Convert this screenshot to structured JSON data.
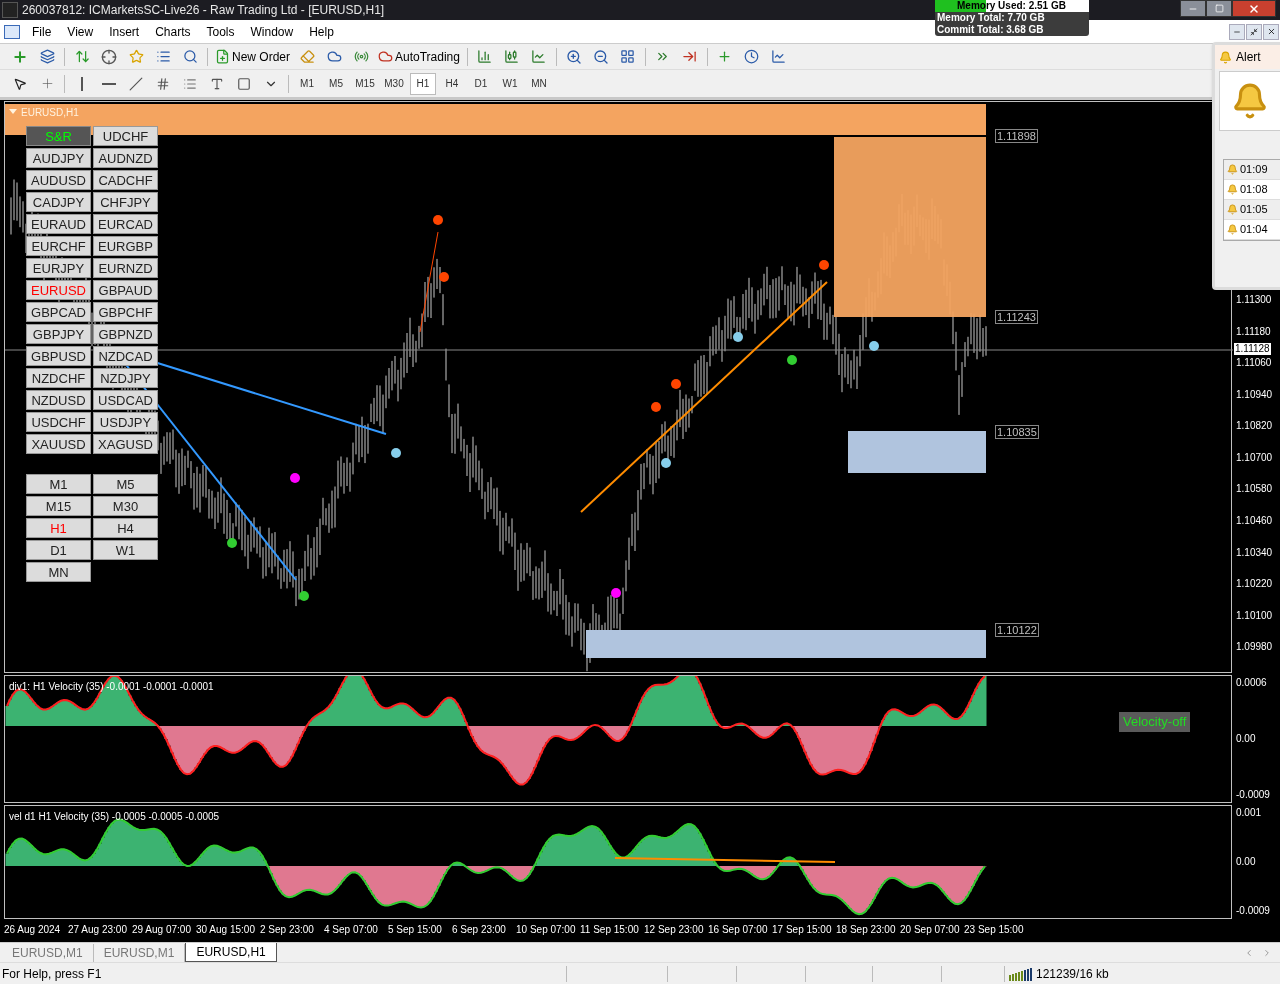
{
  "window": {
    "title": "260037812: ICMarketsSC-Live26 - Raw Trading Ltd - [EURUSD,H1]"
  },
  "memory": {
    "used": "Memory Used: 2.51 GB",
    "level": 0.33,
    "total": "Memory Total: 7.70 GB",
    "commit": "Commit Total: 3.68 GB"
  },
  "menu": [
    "File",
    "View",
    "Insert",
    "Charts",
    "Tools",
    "Window",
    "Help"
  ],
  "toolbar": {
    "new_order": "New Order",
    "auto_trading": "AutoTrading"
  },
  "timeframes": [
    {
      "label": "M1",
      "selected": false
    },
    {
      "label": "M5",
      "selected": false
    },
    {
      "label": "M15",
      "selected": false
    },
    {
      "label": "M30",
      "selected": false
    },
    {
      "label": "H1",
      "selected": true
    },
    {
      "label": "H4",
      "selected": false
    },
    {
      "label": "D1",
      "selected": false
    },
    {
      "label": "W1",
      "selected": false
    },
    {
      "label": "MN",
      "selected": false
    }
  ],
  "chart": {
    "title": "EURUSD,H1",
    "sr_button": "S&R",
    "symbols": [
      {
        "label": "UDCHF",
        "selected": false
      },
      {
        "label": "AUDJPY",
        "selected": false
      },
      {
        "label": "AUDNZD",
        "selected": false
      },
      {
        "label": "AUDUSD",
        "selected": false
      },
      {
        "label": "CADCHF",
        "selected": false
      },
      {
        "label": "CADJPY",
        "selected": false
      },
      {
        "label": "CHFJPY",
        "selected": false
      },
      {
        "label": "EURAUD",
        "selected": false
      },
      {
        "label": "EURCAD",
        "selected": false
      },
      {
        "label": "EURCHF",
        "selected": false
      },
      {
        "label": "EURGBP",
        "selected": false
      },
      {
        "label": "EURJPY",
        "selected": false
      },
      {
        "label": "EURNZD",
        "selected": false
      },
      {
        "label": "EURUSD",
        "selected": true
      },
      {
        "label": "GBPAUD",
        "selected": false
      },
      {
        "label": "GBPCAD",
        "selected": false
      },
      {
        "label": "GBPCHF",
        "selected": false
      },
      {
        "label": "GBPJPY",
        "selected": false
      },
      {
        "label": "GBPNZD",
        "selected": false
      },
      {
        "label": "GBPUSD",
        "selected": false
      },
      {
        "label": "NZDCAD",
        "selected": false
      },
      {
        "label": "NZDCHF",
        "selected": false
      },
      {
        "label": "NZDJPY",
        "selected": false
      },
      {
        "label": "NZDUSD",
        "selected": false
      },
      {
        "label": "USDCAD",
        "selected": false
      },
      {
        "label": "USDCHF",
        "selected": false
      },
      {
        "label": "USDJPY",
        "selected": false
      },
      {
        "label": "XAUUSD",
        "selected": false
      },
      {
        "label": "XAGUSD",
        "selected": false
      }
    ],
    "periods": [
      {
        "label": "M1",
        "selected": false
      },
      {
        "label": "M5",
        "selected": false
      },
      {
        "label": "M15",
        "selected": false
      },
      {
        "label": "M30",
        "selected": false
      },
      {
        "label": "H1",
        "selected": true
      },
      {
        "label": "H4",
        "selected": false
      },
      {
        "label": "D1",
        "selected": false
      },
      {
        "label": "W1",
        "selected": false
      },
      {
        "label": "MN",
        "selected": false
      }
    ],
    "zone_labels": [
      "1.11898",
      "1.11243",
      "1.10835",
      "1.10122"
    ],
    "price_axis": [
      "1.11300",
      "1.11180",
      "1.11060",
      "1.10940",
      "1.10820",
      "1.10700",
      "1.10580",
      "1.10460",
      "1.10340",
      "1.10220",
      "1.10100",
      "1.09980"
    ],
    "current_price": "1.11128"
  },
  "indicators": [
    {
      "title": "div1: H1 Velocity (35) -0.0001 -0.0001 -0.0001",
      "axis": [
        "0.0006",
        "0.00",
        "-0.0009"
      ],
      "button": "Velocity-off"
    },
    {
      "title": "vel d1 H1 Velocity (35) -0.0005 -0.0005 -0.0005",
      "axis": [
        "0.001",
        "0.00",
        "-0.0009"
      ]
    }
  ],
  "dates": [
    "26 Aug 2024",
    "27 Aug 23:00",
    "29 Aug 07:00",
    "30 Aug 15:00",
    "2 Sep 23:00",
    "4 Sep 07:00",
    "5 Sep 15:00",
    "6 Sep 23:00",
    "10 Sep 07:00",
    "11 Sep 15:00",
    "12 Sep 23:00",
    "16 Sep 07:00",
    "17 Sep 15:00",
    "18 Sep 23:00",
    "20 Sep 07:00",
    "23 Sep 15:00"
  ],
  "tabs": [
    {
      "label": "EURUSD,M1",
      "selected": false
    },
    {
      "label": "EURUSD,M1",
      "selected": false
    },
    {
      "label": "EURUSD,H1",
      "selected": true
    }
  ],
  "status": {
    "help": "For Help, press F1",
    "traffic": "121239/16 kb"
  },
  "alert": {
    "title": "Alert",
    "items": [
      "01:09",
      "01:08",
      "01:05",
      "01:04"
    ]
  }
}
